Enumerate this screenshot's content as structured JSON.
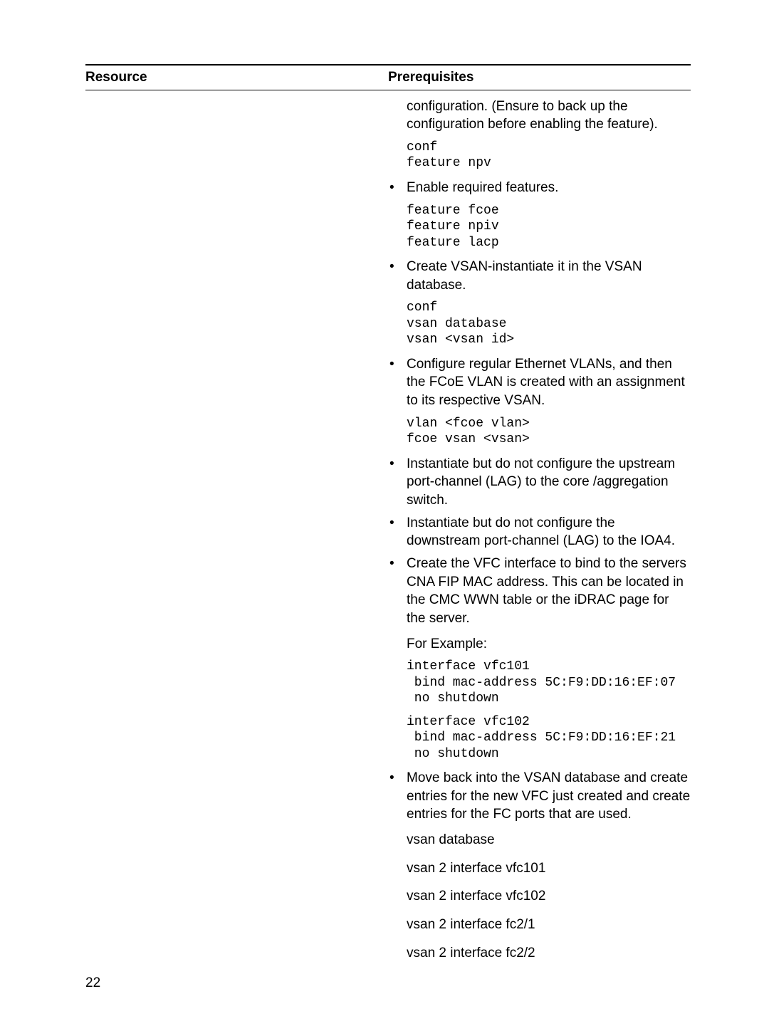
{
  "header": {
    "resource": "Resource",
    "prereq": "Prerequisites"
  },
  "intro": "configuration. (Ensure to back up the configuration before enabling the feature).",
  "code1a": "conf",
  "code1b": "feature npv",
  "b1": "Enable required features.",
  "code2a": "feature fcoe",
  "code2b": "feature npiv",
  "code2c": "feature lacp",
  "b2": "Create VSAN-instantiate it in the VSAN database.",
  "code3a": "conf",
  "code3b": "vsan database",
  "code3c": "vsan <vsan id>",
  "b3": "Configure regular Ethernet VLANs, and then the FCoE VLAN is created with an assignment to its respective VSAN.",
  "code4a": "vlan <fcoe vlan>",
  "code4b": "fcoe vsan <vsan>",
  "b4": "Instantiate but do not configure the upstream port-channel (LAG) to the core /aggregation switch.",
  "b5": "Instantiate but do not configure the downstream port-channel (LAG) to the IOA4.",
  "b6": "Create the VFC interface to bind to the servers CNA FIP MAC address. This can be located in the CMC WWN table or the iDRAC page for the server.",
  "forex": "For Example:",
  "code5a": "interface vfc101",
  "code5b": " bind mac-address 5C:F9:DD:16:EF:07",
  "code5c": " no shutdown",
  "code6a": "interface vfc102",
  "code6b": " bind mac-address 5C:F9:DD:16:EF:21",
  "code6c": " no shutdown",
  "b7": "Move back into the VSAN database and create entries for the new VFC just created and create entries for the FC ports that are used.",
  "l1": "vsan database",
  "l2": "vsan 2 interface vfc101",
  "l3": "vsan 2 interface vfc102",
  "l4": "vsan 2 interface fc2/1",
  "l5": "vsan 2 interface fc2/2",
  "pgnum": "22"
}
